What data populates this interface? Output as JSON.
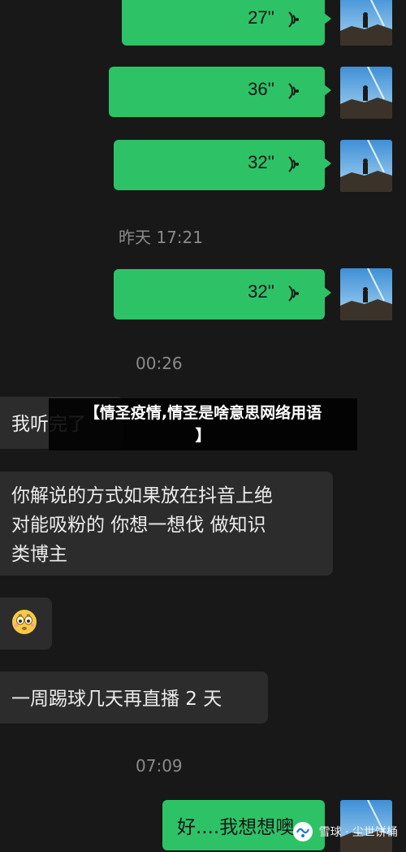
{
  "voice_messages": [
    {
      "duration": "27''"
    },
    {
      "duration": "36''"
    },
    {
      "duration": "32''"
    },
    {
      "duration": "32''"
    }
  ],
  "timestamps": [
    "昨天 17:21",
    "00:26",
    "07:09"
  ],
  "incoming": [
    {
      "text": "我听完了"
    },
    {
      "line1": "你解说的方式如果放在抖音上绝",
      "line2": "对能吸粉的 你想一想伐 做知识",
      "line3": "类博主"
    },
    {
      "emoji": "flushed-face-icon"
    },
    {
      "text": "一周踢球几天再直播 2 天"
    }
  ],
  "outgoing_text": "好....我想想噢",
  "overlay": {
    "line1": "【情圣疫情,情圣是啥意思网络用语",
    "line2": "】"
  },
  "watermark": {
    "text": "雪球 · 尘世饼桶"
  },
  "colors": {
    "bubble_out": "#2ec267",
    "bubble_in": "#2c2c2c",
    "background": "#181818"
  }
}
